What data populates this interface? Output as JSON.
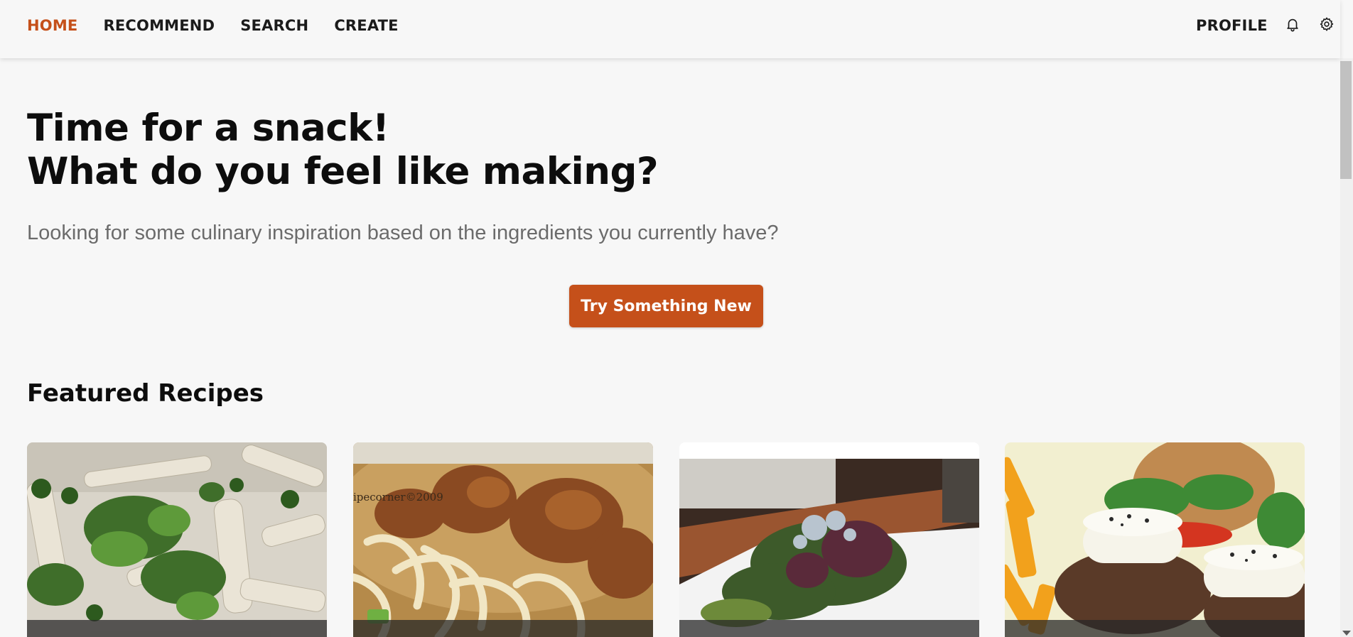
{
  "nav": {
    "links": [
      "HOME",
      "RECOMMEND",
      "SEARCH",
      "CREATE"
    ],
    "active": "HOME",
    "profile_label": "PROFILE",
    "icons": [
      "bell-icon",
      "gear-icon"
    ]
  },
  "hero": {
    "title_line1": "Time for a snack!",
    "title_line2": "What do you feel like making?",
    "subtitle": "Looking for some culinary inspiration based on the ingredients you currently have?",
    "cta_label": "Try Something New"
  },
  "featured": {
    "title": "Featured Recipes",
    "cards": [
      {
        "image": "pasta-with-peas-and-basil"
      },
      {
        "image": "udon-noodle-soup-with-fried-chicken",
        "watermark": "ipecorner©2009"
      },
      {
        "image": "green-salad-with-blue-cheese"
      },
      {
        "image": "burger-patties-with-goat-cheese-and-fries"
      }
    ]
  },
  "colors": {
    "accent": "#c5501a",
    "background": "#f7f7f7",
    "text": "#111111",
    "muted": "#6b6b6b"
  }
}
